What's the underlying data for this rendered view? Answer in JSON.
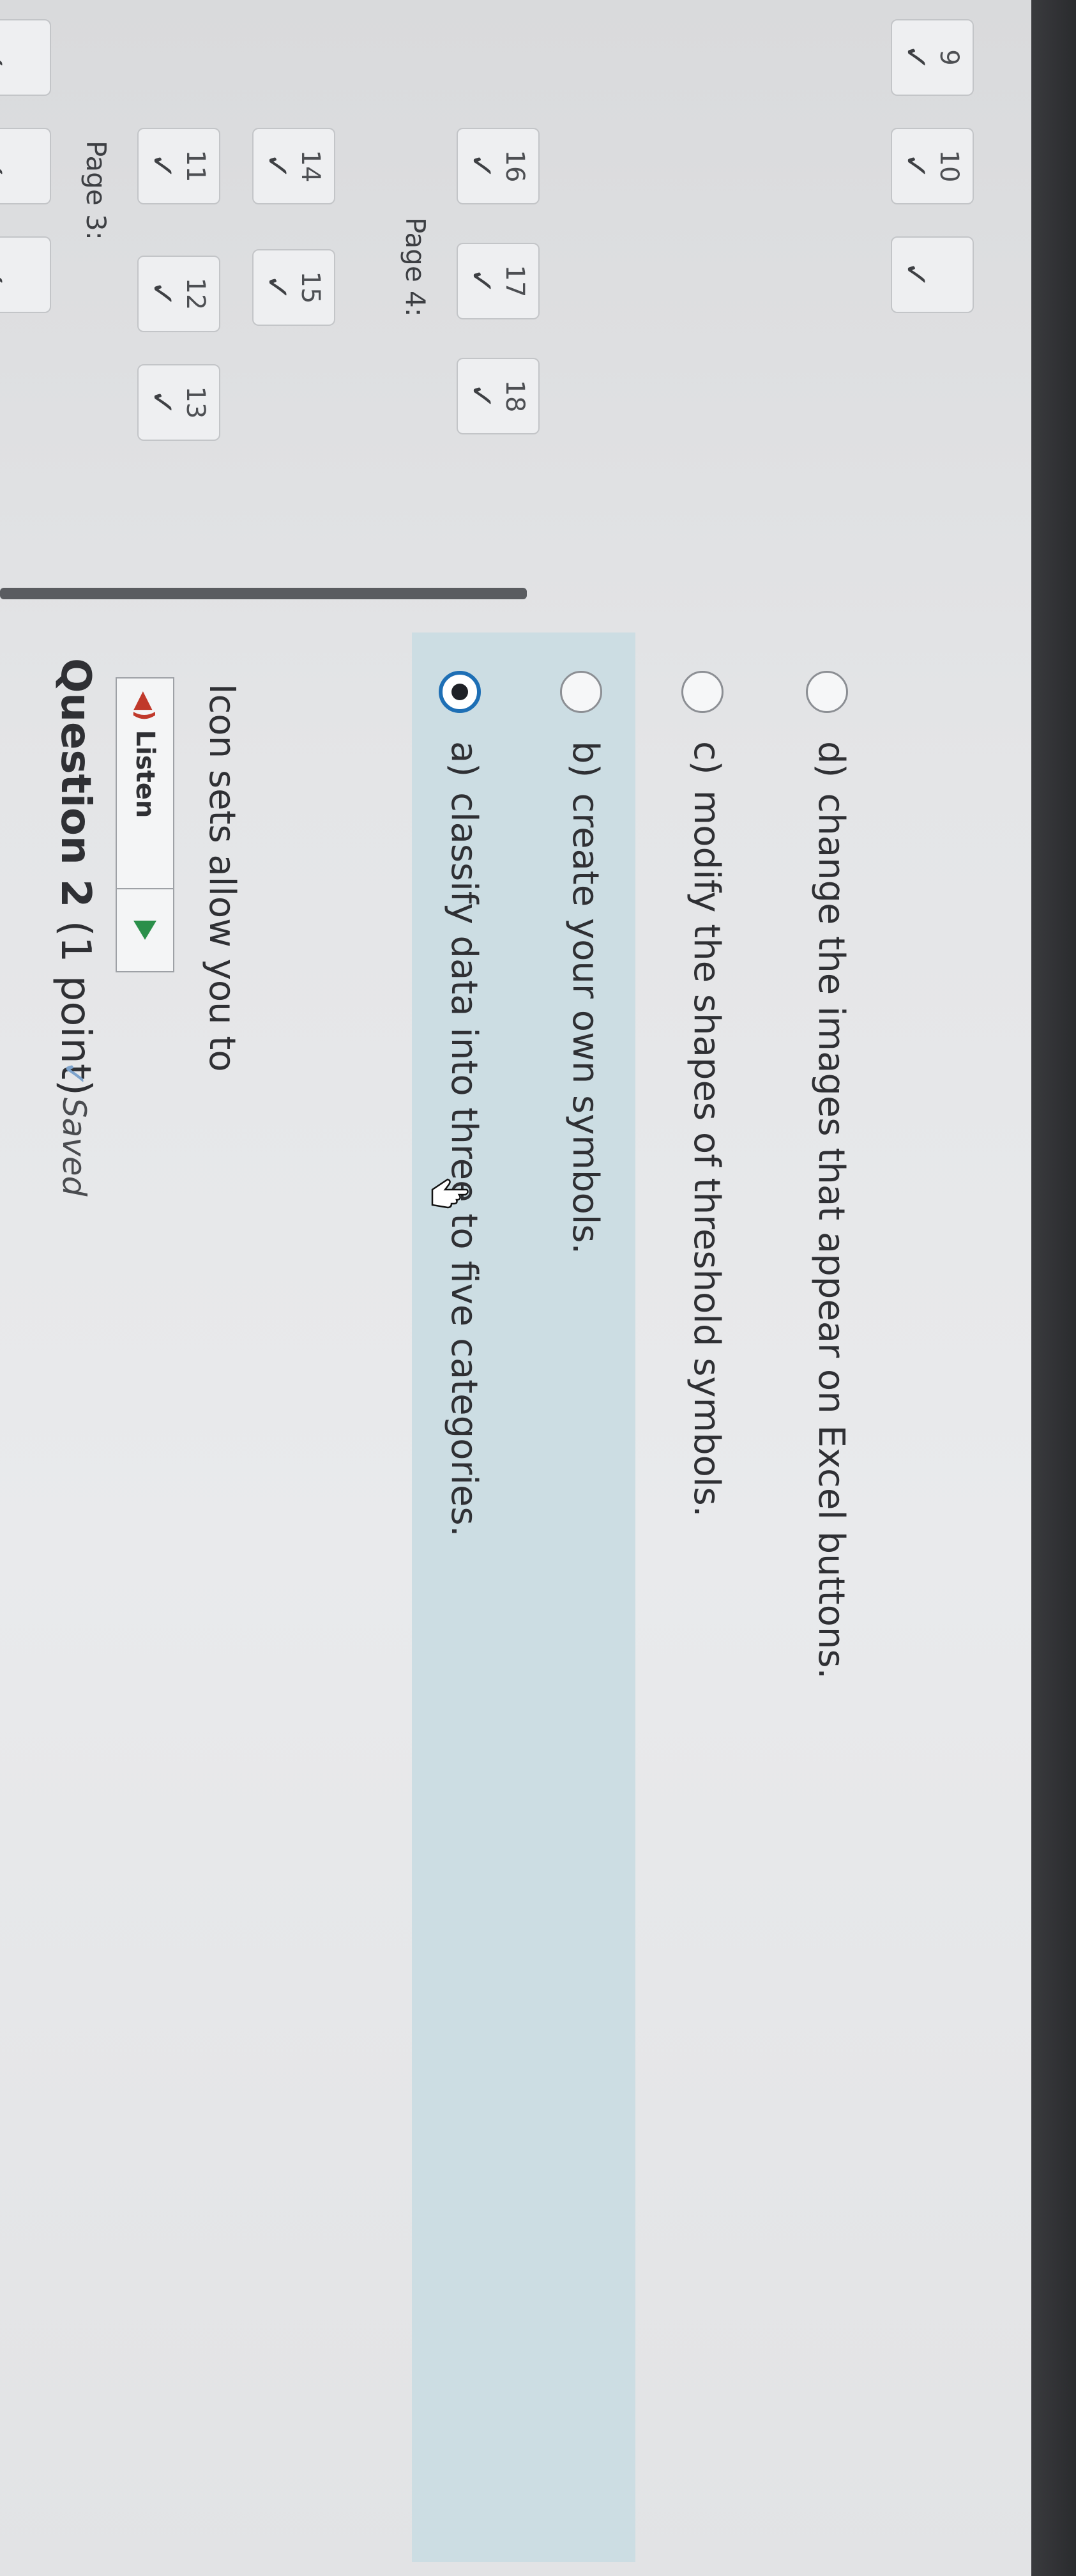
{
  "nav": {
    "top_row": [
      {
        "number": "9",
        "mark": "✓"
      },
      {
        "number": "10",
        "mark": "✓"
      },
      {
        "number": "",
        "mark": "✓"
      }
    ],
    "partial_row": [
      {
        "number": "",
        "mark": "✓"
      },
      {
        "number": "",
        "mark": "✓"
      },
      {
        "number": "",
        "mark": "✓"
      }
    ],
    "page3_label": "Page 3:",
    "page3_row1": [
      {
        "number": "11",
        "mark": "✓"
      },
      {
        "number": "12",
        "mark": "✓"
      },
      {
        "number": "13",
        "mark": "✓"
      }
    ],
    "page3_row2": [
      {
        "number": "14",
        "mark": "✓"
      },
      {
        "number": "15",
        "mark": "✓"
      }
    ],
    "page4_label": "Page 4:",
    "page4_row": [
      {
        "number": "16",
        "mark": "✓"
      },
      {
        "number": "17",
        "mark": "✓"
      },
      {
        "number": "18",
        "mark": "✓"
      }
    ]
  },
  "question": {
    "title_bold": "Question 2",
    "title_points": "(1 point)",
    "saved_mark": "✓",
    "saved_label": "Saved",
    "listen_icon": "◀)",
    "listen_label": "Listen",
    "stem": "Icon sets allow you to",
    "options": [
      {
        "letter": "a)",
        "text": "classify data into three to five categories.",
        "selected": true
      },
      {
        "letter": "b)",
        "text": "create your own symbols.",
        "selected": false
      },
      {
        "letter": "c)",
        "text": "modify the shapes of threshold symbols.",
        "selected": false
      },
      {
        "letter": "d)",
        "text": "change the images that appear on Excel buttons.",
        "selected": false
      }
    ]
  },
  "colors": {
    "highlight": "#ccdde3",
    "radio_selected": "#1e6fb5",
    "play_icon": "#2a8f4a",
    "speaker_icon": "#c0392b"
  }
}
